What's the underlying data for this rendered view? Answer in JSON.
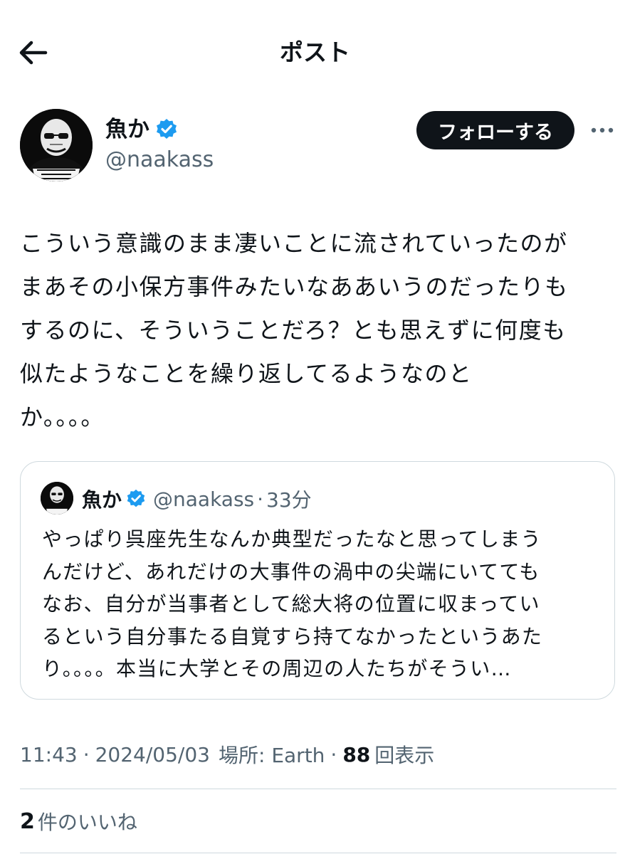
{
  "header": {
    "title": "ポスト",
    "back_icon": "arrow-left-icon"
  },
  "author": {
    "display_name": "魚か",
    "handle": "@naakass",
    "verified_icon": "verified-badge-icon",
    "verified_color": "#1d9bf0"
  },
  "actions": {
    "follow_label": "フォローする",
    "more_icon": "more-horizontal-icon"
  },
  "post": {
    "lines": [
      "こういう意識のまま凄いことに流されていったのが",
      "まあその小保方事件みたいなああいうのだったりも",
      "するのに、そういうことだろ？とも思えずに何度も",
      "似たようなことを繰り返してるようなのと",
      "か。。。。"
    ]
  },
  "quote": {
    "display_name": "魚か",
    "handle": "@naakass",
    "separator": "·",
    "time": "33分",
    "lines": [
      "やっぱり呉座先生なんか典型だったなと思ってしまう",
      "んだけど、あれだけの大事件の渦中の尖端にいてても",
      "なお、自分が当事者として総大将の位置に収まってい",
      "るという自分事たる自覚すら持てなかったというあた",
      "り。。。。本当に大学とその周辺の人たちがそうい…"
    ]
  },
  "meta": {
    "time": "11:43",
    "separator": "·",
    "date": "2024/05/03",
    "location": "場所: Earth",
    "views_count": "88",
    "views_label": "回表示"
  },
  "likes": {
    "count": "2",
    "label": "件のいいね"
  },
  "colors": {
    "text_primary": "#0f1419",
    "text_secondary": "#536471",
    "border": "#cfd9de",
    "accent": "#1d9bf0"
  }
}
